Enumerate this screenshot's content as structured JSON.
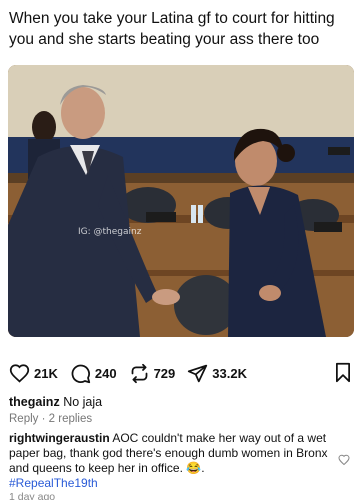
{
  "post": {
    "caption": "When you take your Latina gf to court for hitting you and she starts beating your ass there too",
    "watermark": "IG: @thegainz"
  },
  "actions": {
    "likes": "21K",
    "comments": "240",
    "reposts": "729",
    "shares": "33.2K"
  },
  "comments": [
    {
      "username": "thegainz",
      "text": "No jaja",
      "reply_label": "Reply",
      "separator": "·",
      "replies_label": "2 replies"
    },
    {
      "username": "rightwingeraustin",
      "text": "AOC couldn't make her way out of a wet paper bag,  thank god there's enough dumb women in Bronx and queens to keep her in office.",
      "emoji": "😂",
      "emoji_after": ".",
      "hashtag": "#RepealThe19th",
      "time": "1 day ago"
    }
  ],
  "colors": {
    "hashtag": "#2a5bd7",
    "secondary_text": "#777777"
  },
  "icons": [
    "heart-icon",
    "comment-icon",
    "repost-icon",
    "share-icon",
    "bookmark-icon"
  ]
}
